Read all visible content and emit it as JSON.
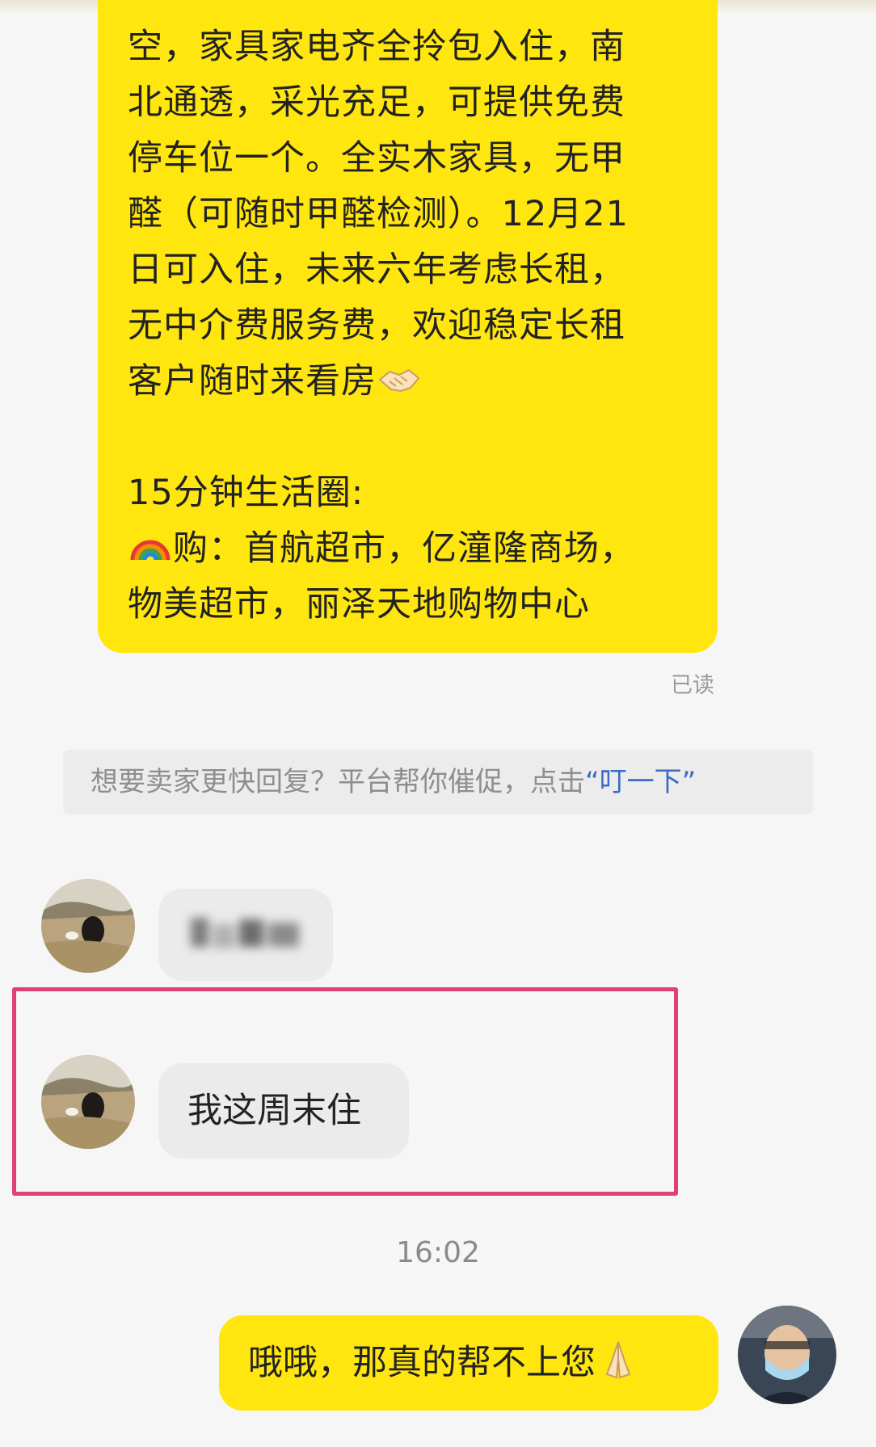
{
  "chat": {
    "listing_message": {
      "lines": [
        "空，家具家电齐全拎包入住，南",
        "北通透，采光充足，可提供免费",
        "停车位一个。全实木家具，无甲",
        "醛（可随时甲醛检测）。12月21",
        "日可入住，未来六年考虑长租，",
        "无中介费服务费，欢迎稳定长租",
        "客户随时来看房"
      ],
      "circle_title": "15分钟生活圈:",
      "shopping_line1": "购：首航超市，亿潼隆商场，",
      "shopping_line2": "物美超市，丽泽天地购物中心",
      "handshake_icon": "handshake-icon",
      "rainbow_icon": "rainbow-icon"
    },
    "read_status": "已读",
    "hint": {
      "text": "想要卖家更快回复？平台帮你催促，点击",
      "open_quote": "“",
      "link": "叮一下",
      "close_quote": "”"
    },
    "buyer_message_blurred": "██████",
    "buyer_message": "我这周末住",
    "timestamp": "16:02",
    "seller_reply": "哦哦，那真的帮不上您",
    "pray_icon": "folded-hands-icon",
    "colors": {
      "seller_bubble": "#ffe60f",
      "buyer_bubble": "#ebebeb",
      "highlight_border": "#e0407a",
      "link": "#3a6cc5"
    }
  }
}
